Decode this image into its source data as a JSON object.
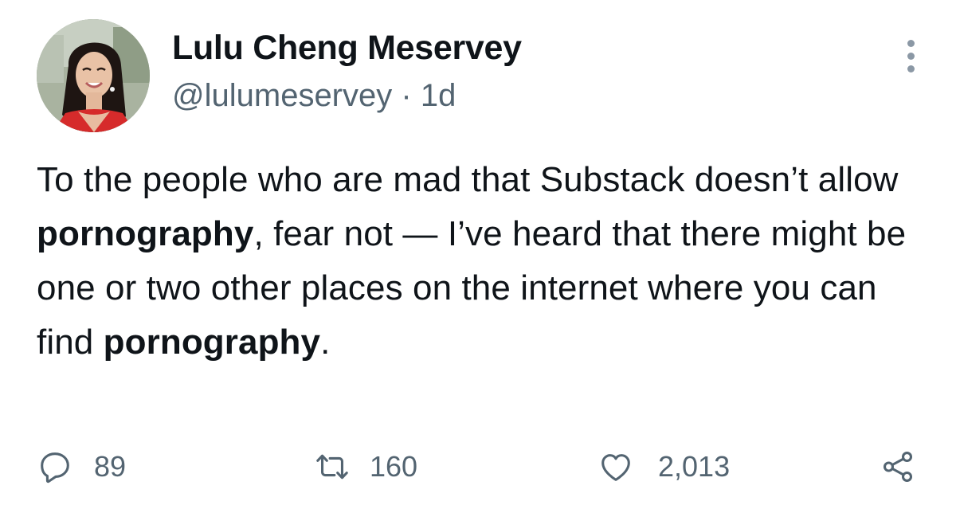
{
  "author": {
    "display_name": "Lulu Cheng Meservey",
    "handle": "@lulumeservey",
    "separator": "·",
    "timestamp": "1d",
    "avatar_icon": "profile-photo"
  },
  "tweet": {
    "segments": [
      {
        "text": "To the people who are mad that Substack doesn’t allow ",
        "bold": false
      },
      {
        "text": "pornography",
        "bold": true
      },
      {
        "text": ", fear not — I’ve heard that there might be one or two other places on the internet where you can find ",
        "bold": false
      },
      {
        "text": "pornography",
        "bold": true
      },
      {
        "text": ".",
        "bold": false
      }
    ]
  },
  "actions": {
    "reply": {
      "icon": "reply-icon",
      "count": "89"
    },
    "retweet": {
      "icon": "retweet-icon",
      "count": "160"
    },
    "like": {
      "icon": "heart-icon",
      "count": "2,013"
    },
    "share": {
      "icon": "share-icon"
    }
  },
  "colors": {
    "text_primary": "#0f1419",
    "text_secondary": "#536471",
    "background": "#ffffff"
  }
}
